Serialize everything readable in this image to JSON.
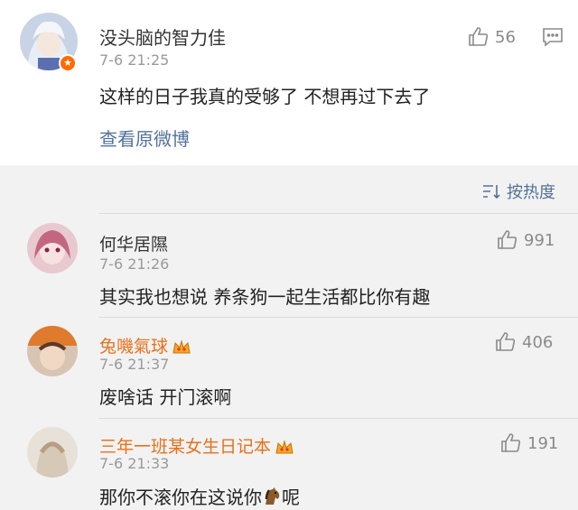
{
  "post": {
    "author": "没头脑的智力佳",
    "time": "7-6 21:25",
    "text": "这样的日子我真的受够了 不想再过下去了",
    "likes": "56",
    "view_original": "查看原微博",
    "badge_icon": "star-badge-icon"
  },
  "sort": {
    "label": "按热度"
  },
  "comments": [
    {
      "name": "何华居隰",
      "time": "7-6 21:26",
      "text": "其实我也想说 养条狗一起生活都比你有趣",
      "likes": "991",
      "name_color": "#333333"
    },
    {
      "name": "兔嘰氣球",
      "time": "7-6 21:37",
      "text": "废啥话 开门滚啊",
      "likes": "406",
      "name_color": "#e8711a"
    },
    {
      "name": "三年一班某女生日记本",
      "time": "7-6 21:33",
      "text_before": "那你不滚你在这说你",
      "text_after": "呢",
      "likes": "191",
      "name_color": "#e8711a"
    }
  ],
  "colors": {
    "link": "#52729a",
    "vip_name": "#e8711a",
    "meta": "#9a9a9a",
    "background": "#f2f2f2"
  }
}
